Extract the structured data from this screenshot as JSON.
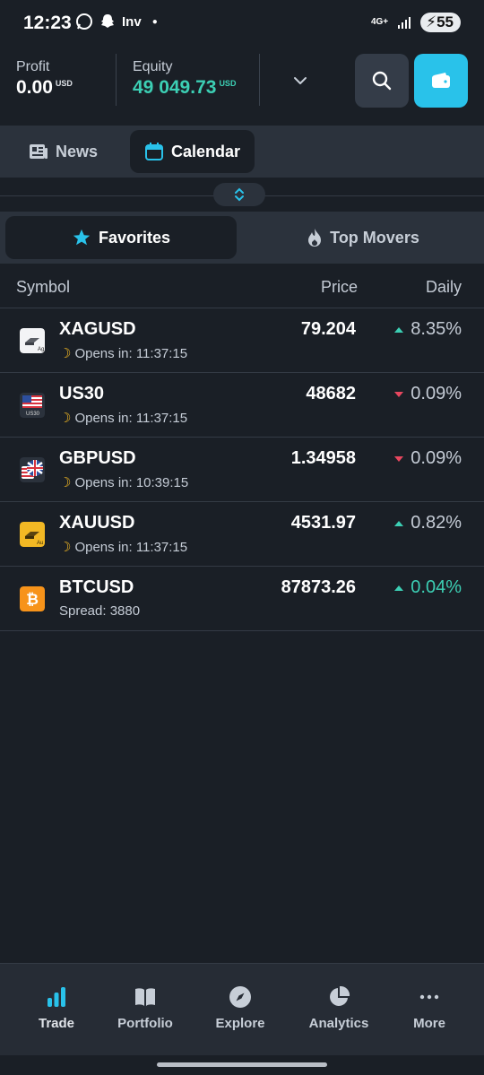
{
  "status_bar": {
    "time": "12:23",
    "notif_label": "Inv",
    "network": "4G+",
    "battery": "55"
  },
  "account": {
    "profit_label": "Profit",
    "profit_value": "0.00",
    "profit_unit": "USD",
    "equity_label": "Equity",
    "equity_value": "49 049.73",
    "equity_unit": "USD"
  },
  "segments": [
    {
      "label": "News",
      "icon": "newspaper-icon",
      "active": false
    },
    {
      "label": "Calendar",
      "icon": "calendar-icon",
      "active": true
    }
  ],
  "filters": [
    {
      "label": "Favorites",
      "icon": "star-icon",
      "active": true
    },
    {
      "label": "Top Movers",
      "icon": "flame-icon",
      "active": false
    }
  ],
  "table": {
    "headers": {
      "symbol": "Symbol",
      "price": "Price",
      "daily": "Daily"
    },
    "rows": [
      {
        "symbol": "XAGUSD",
        "sub": "Opens in: 11:37:15",
        "price": "79.204",
        "daily": "8.35%",
        "direction": "up",
        "icon": "silver-bar-icon"
      },
      {
        "symbol": "US30",
        "sub": "Opens in: 11:37:15",
        "price": "48682",
        "daily": "0.09%",
        "direction": "down",
        "icon": "us-flag-icon"
      },
      {
        "symbol": "GBPUSD",
        "sub": "Opens in: 10:39:15",
        "price": "1.34958",
        "daily": "0.09%",
        "direction": "down",
        "icon": "uk-us-flag-icon"
      },
      {
        "symbol": "XAUUSD",
        "sub": "Opens in: 11:37:15",
        "price": "4531.97",
        "daily": "0.82%",
        "direction": "up",
        "icon": "gold-bar-icon"
      },
      {
        "symbol": "BTCUSD",
        "sub": "Spread: 3880",
        "price": "87873.26",
        "daily": "0.04%",
        "direction": "up",
        "icon": "bitcoin-icon"
      }
    ],
    "icon_captions": {
      "silver": "Ag",
      "us30": "US30",
      "gold": "Au",
      "btc": "₿"
    }
  },
  "bottom_nav": [
    {
      "label": "Trade",
      "icon": "bar-chart-icon",
      "active": true
    },
    {
      "label": "Portfolio",
      "icon": "book-icon",
      "active": false
    },
    {
      "label": "Explore",
      "icon": "compass-icon",
      "active": false
    },
    {
      "label": "Analytics",
      "icon": "pie-chart-icon",
      "active": false
    },
    {
      "label": "More",
      "icon": "ellipsis-icon",
      "active": false
    }
  ],
  "colors": {
    "background": "#1a1f26",
    "accent": "#29c2ea",
    "positive": "#3ccfb4",
    "negative": "#e8475f"
  }
}
